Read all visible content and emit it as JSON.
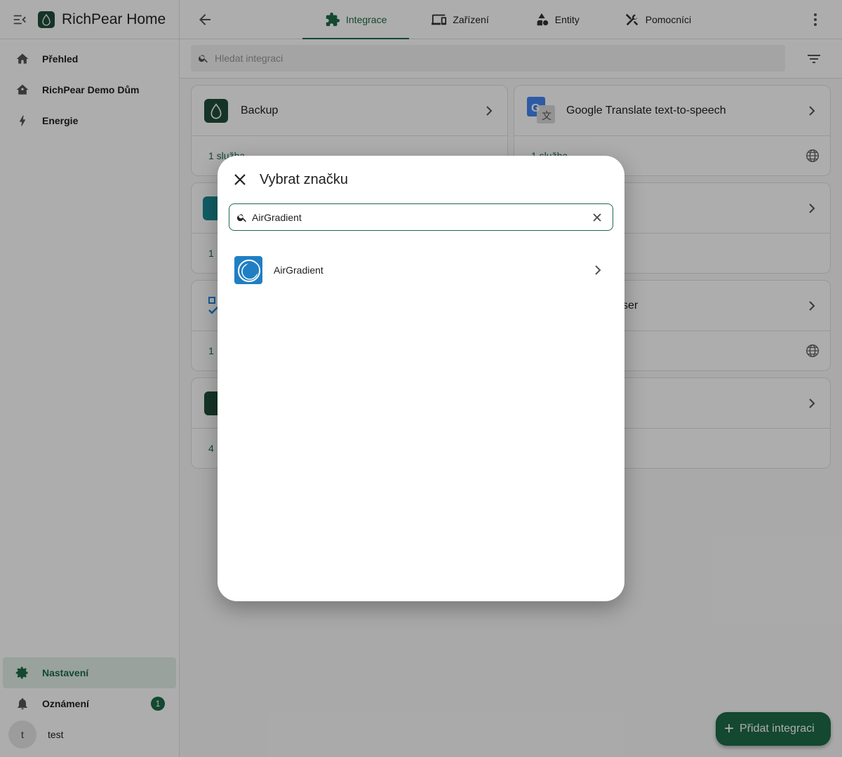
{
  "app": {
    "title": "RichPear Home"
  },
  "sidebar": {
    "items": [
      {
        "label": "Přehled",
        "icon": "home-icon"
      },
      {
        "label": "RichPear Demo Dům",
        "icon": "home-roof-icon"
      },
      {
        "label": "Energie",
        "icon": "lightning-icon"
      }
    ],
    "bottom": {
      "settings": "Nastavení",
      "notifications": "Oznámení",
      "notifications_count": "1",
      "user_initial": "t",
      "user_name": "test"
    }
  },
  "tabs": [
    {
      "label": "Integrace",
      "active": true
    },
    {
      "label": "Zařízení"
    },
    {
      "label": "Entity"
    },
    {
      "label": "Pomocníci"
    }
  ],
  "search": {
    "placeholder": "Hledat integraci"
  },
  "cards": [
    {
      "title": "Backup",
      "footer": "1 služba"
    },
    {
      "title": "Google Translate text-to-speech",
      "footer": "1 služba"
    },
    {
      "title": "",
      "footer": "1"
    },
    {
      "title": "",
      "footer": ""
    },
    {
      "title": "",
      "footer": "1"
    },
    {
      "title": "ser",
      "footer": ""
    },
    {
      "title": "",
      "footer": "4"
    },
    {
      "title": "",
      "footer": ""
    }
  ],
  "fab": {
    "label": "Přidat integraci"
  },
  "dialog": {
    "title": "Vybrat značku",
    "search_value": "AirGradient",
    "results": [
      {
        "name": "AirGradient"
      }
    ]
  },
  "colors": {
    "primary": "#1e6b47",
    "brand_logo": "#1f7fc4"
  }
}
